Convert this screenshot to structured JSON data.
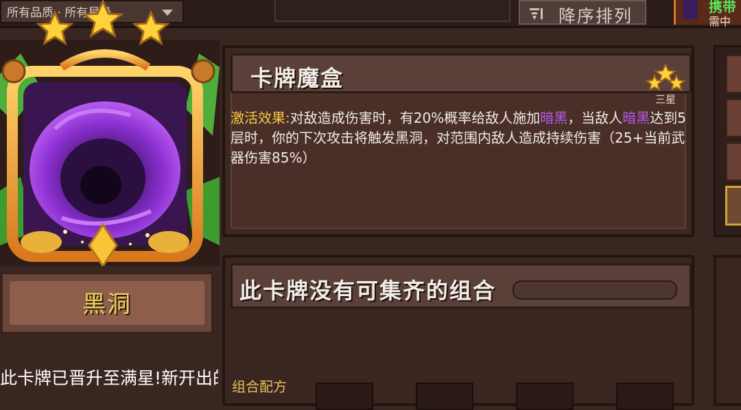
{
  "top_bar": {
    "filter_text": "所有品质 · 所有星级",
    "sort_label": "降序排列",
    "carry_label": "携带",
    "carry_sub": "需中"
  },
  "card": {
    "name": "黑洞",
    "star_count": 3,
    "maxed_text": "此卡牌已晋升至满星!新开出的对应碎片会转换"
  },
  "effect_panel": {
    "title": "卡牌魔盒",
    "star_label": "三星",
    "desc_prefix": "激活效果:",
    "desc_part1": "对敌造成伤害时，有20%概率给敌人施加",
    "desc_kw1": "暗黑",
    "desc_part2": "，当敌人",
    "desc_kw2": "暗黑",
    "desc_part3": "达到5层时，你的下次攻击将触发黑洞，对范围内敌人造成持续伤害（25+当前武器伤害85%）"
  },
  "combo_panel": {
    "title": "此卡牌没有可集齐的组合",
    "recipe_label": "组合配方"
  },
  "colors": {
    "highlight_yellow": "#f5c842",
    "keyword_purple": "#b45be8",
    "card_name_gold": "#f1d45a"
  }
}
